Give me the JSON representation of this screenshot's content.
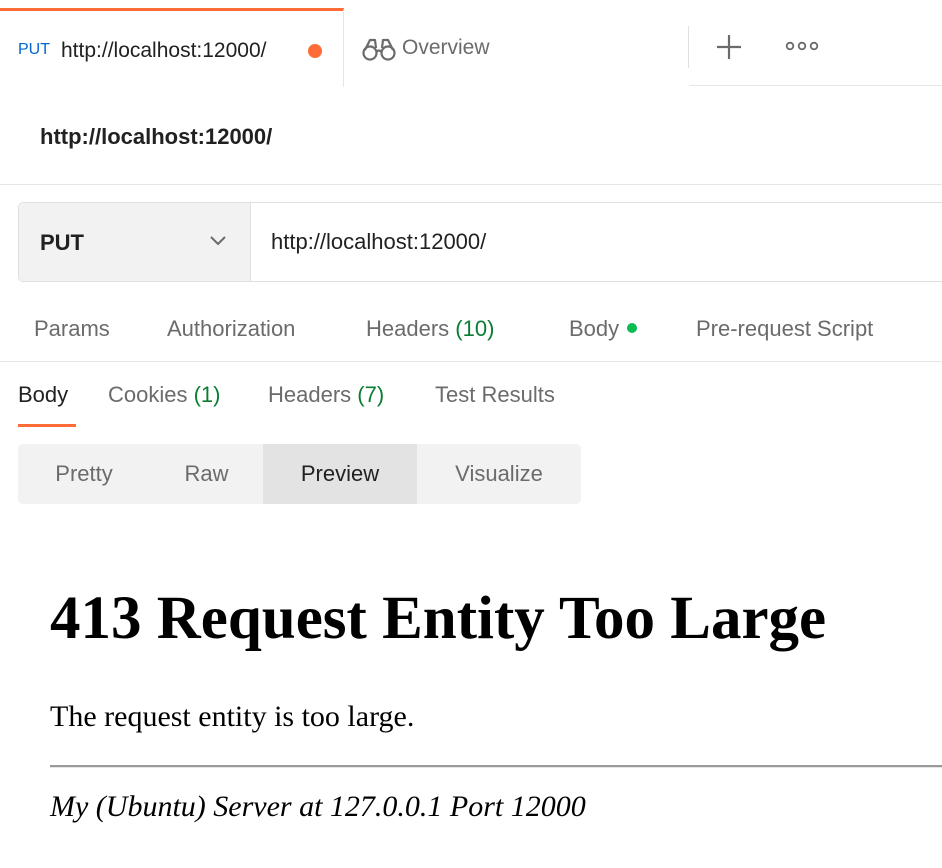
{
  "tabs": {
    "active": {
      "method": "PUT",
      "url": "http://localhost:12000/",
      "unsaved_indicator_color": "#ff6c37"
    },
    "overview": {
      "label": "Overview",
      "icon": "binoculars-icon"
    },
    "new_tab_icon": "plus-icon",
    "more_icon": "more-horizontal-icon"
  },
  "request": {
    "title": "http://localhost:12000/",
    "method": "PUT",
    "url": "http://localhost:12000/"
  },
  "request_tabs": [
    {
      "label": "Params"
    },
    {
      "label": "Authorization"
    },
    {
      "label": "Headers",
      "count": "(10)"
    },
    {
      "label": "Body",
      "indicator": "green-dot"
    },
    {
      "label": "Pre-request Script"
    }
  ],
  "response_tabs": [
    {
      "label": "Body",
      "active": true
    },
    {
      "label": "Cookies",
      "count": "(1)"
    },
    {
      "label": "Headers",
      "count": "(7)"
    },
    {
      "label": "Test Results"
    }
  ],
  "view_modes": [
    {
      "label": "Pretty"
    },
    {
      "label": "Raw"
    },
    {
      "label": "Preview",
      "active": true
    },
    {
      "label": "Visualize"
    }
  ],
  "preview": {
    "heading": "413 Request Entity Too Large",
    "message": "The request entity is too large.",
    "server_signature": "My (Ubuntu) Server at 127.0.0.1 Port 12000"
  },
  "colors": {
    "accent": "#ff6c37",
    "method_blue": "#0265d2",
    "count_green": "#0a7d33",
    "indicator_green": "#0cbb52"
  }
}
